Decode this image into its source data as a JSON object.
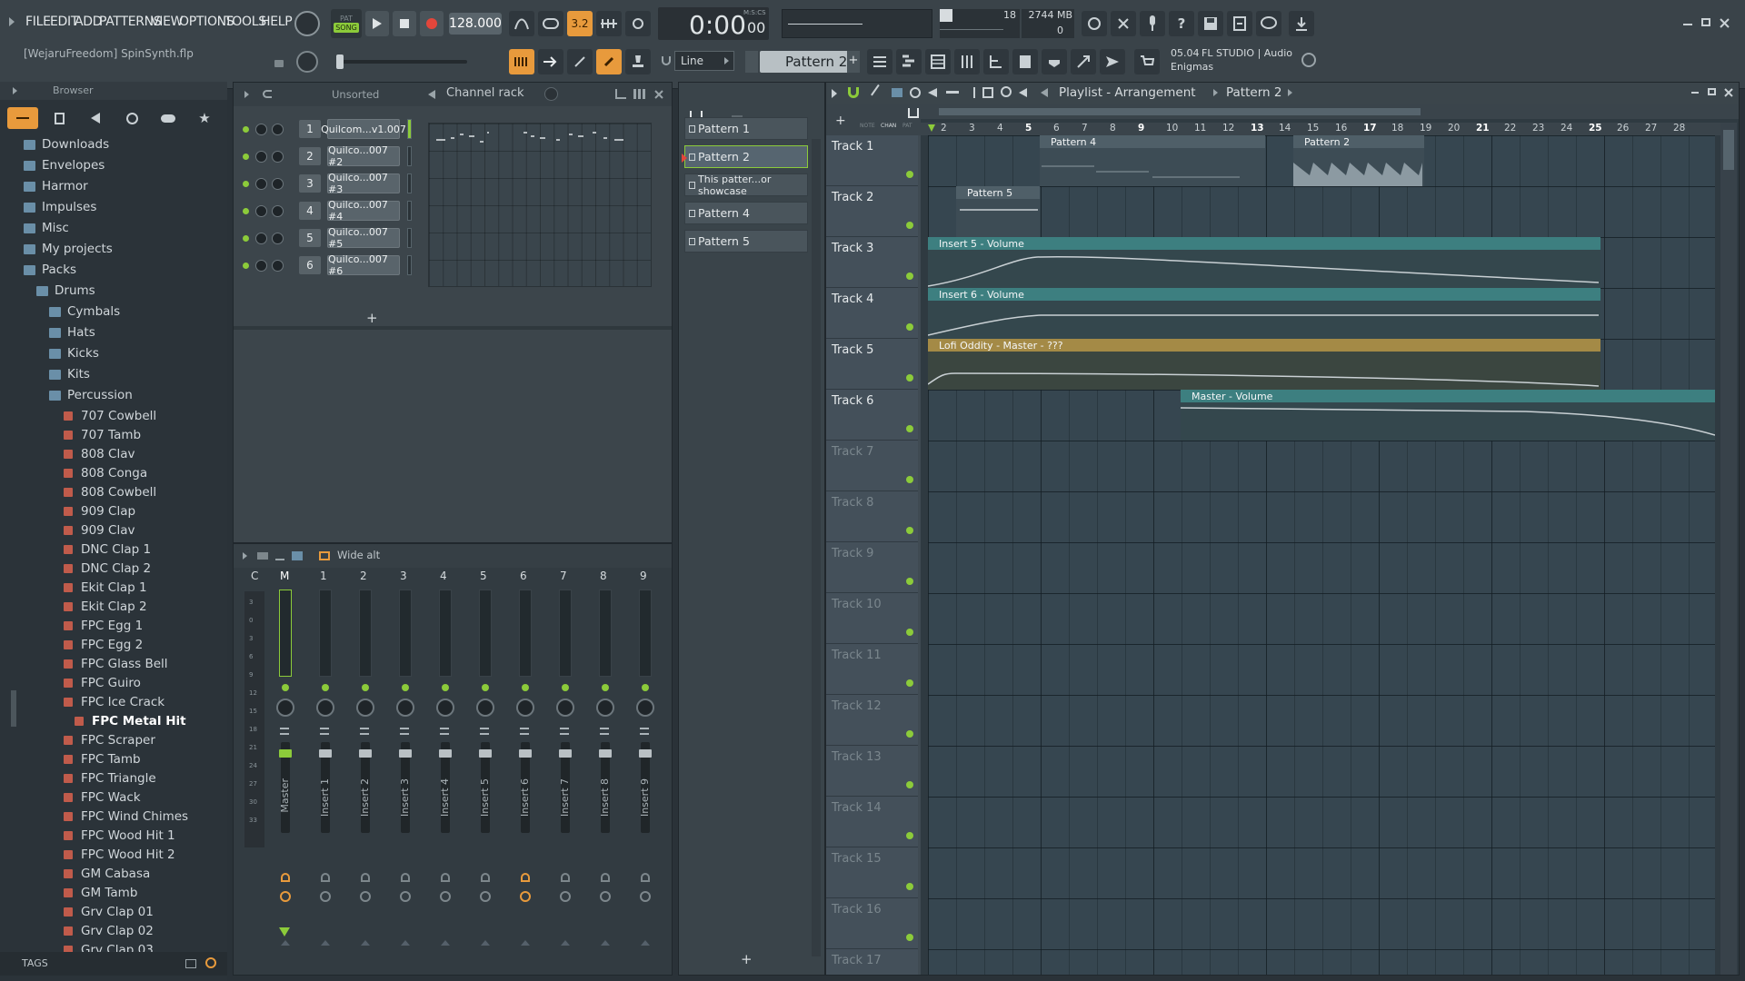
{
  "menu": [
    "FILE",
    "EDIT",
    "ADD",
    "PATTERNS",
    "VIEW",
    "OPTIONS",
    "TOOLS",
    "HELP"
  ],
  "project": {
    "file_label": "[WejaruFreedom] SpinSynth.flp"
  },
  "transport": {
    "mode_pat": "PAT",
    "mode_song": "SONG",
    "tempo": "128.000",
    "time": "0:00",
    "time_small": "00",
    "time_unit": "M:S:CS",
    "snap": "Line",
    "pattern": "Pattern 2",
    "small_digits": "3.2"
  },
  "meter": {
    "cpu": "18",
    "ram": "2744 MB",
    "poly": "0"
  },
  "news": {
    "version": "05.04",
    "text1": "FL STUDIO | Audio",
    "text2": "Enigmas"
  },
  "browser": {
    "title": "Browser",
    "folders": [
      "Downloads",
      "Envelopes",
      "Harmor",
      "Impulses",
      "Misc",
      "My projects",
      "Packs",
      "Drums",
      "Cymbals",
      "Hats",
      "Kicks",
      "Kits",
      "Percussion"
    ],
    "files": [
      "707 Cowbell",
      "707 Tamb",
      "808 Clav",
      "808 Conga",
      "808 Cowbell",
      "909 Clap",
      "909 Clav",
      "DNC Clap 1",
      "DNC Clap 2",
      "Ekit Clap 1",
      "Ekit Clap 2",
      "FPC Egg 1",
      "FPC Egg 2",
      "FPC Glass Bell",
      "FPC Guiro",
      "FPC Ice Crack",
      "FPC Metal Hit",
      "FPC Scraper",
      "FPC Tamb",
      "FPC Triangle",
      "FPC Wack",
      "FPC Wind Chimes",
      "FPC Wood Hit 1",
      "FPC Wood Hit 2",
      "GM Cabasa",
      "GM Tamb",
      "Grv Clap 01",
      "Grv Clap 02",
      "Grv Clap 03"
    ],
    "selected": "FPC Metal Hit",
    "tags": "TAGS"
  },
  "channel_rack": {
    "title": "Channel rack",
    "filter": "Unsorted",
    "channels": [
      {
        "num": "1",
        "name": "Quilcom...v1.007"
      },
      {
        "num": "2",
        "name": "Quilco...007 #2"
      },
      {
        "num": "3",
        "name": "Quilco...007 #3"
      },
      {
        "num": "4",
        "name": "Quilco...007 #4"
      },
      {
        "num": "5",
        "name": "Quilco...007 #5"
      },
      {
        "num": "6",
        "name": "Quilco...007 #6"
      }
    ],
    "add": "+"
  },
  "mixer": {
    "preset": "Wide alt",
    "strips": [
      "C",
      "M",
      "1",
      "2",
      "3",
      "4",
      "5",
      "6",
      "7",
      "8",
      "9"
    ],
    "scale": [
      "3",
      "0",
      "3",
      "6",
      "9",
      "12",
      "15",
      "18",
      "21",
      "24",
      "27",
      "30",
      "33"
    ],
    "labels": [
      "Master",
      "Insert 1",
      "Insert 2",
      "Insert 3",
      "Insert 4",
      "Insert 5",
      "Insert 6",
      "Insert 7",
      "Insert 8",
      "Insert 9"
    ]
  },
  "picker": {
    "patterns": [
      "Pattern 1",
      "Pattern 2",
      "This patter...or showcase",
      "Pattern 4",
      "Pattern 5"
    ],
    "add": "+"
  },
  "playlist": {
    "title": "Playlist - Arrangement",
    "crumb": "Pattern 2",
    "header_labels": [
      "NOTE",
      "CHAN",
      "PAT"
    ],
    "ruler": [
      "2",
      "3",
      "4",
      "5",
      "6",
      "7",
      "8",
      "9",
      "10",
      "11",
      "12",
      "13",
      "14",
      "15",
      "16",
      "17",
      "18",
      "19",
      "20",
      "21",
      "22",
      "23",
      "24",
      "25",
      "26",
      "27",
      "28"
    ],
    "tracks": [
      "Track 1",
      "Track 2",
      "Track 3",
      "Track 4",
      "Track 5",
      "Track 6",
      "Track 7",
      "Track 8",
      "Track 9",
      "Track 10",
      "Track 11",
      "Track 12",
      "Track 13",
      "Track 14",
      "Track 15",
      "Track 16",
      "Track 17"
    ],
    "clips": {
      "t1a": "Pattern 4",
      "t1b": "Pattern 2",
      "t2": "Pattern 5",
      "t3": "Insert 5 - Volume",
      "t4": "Insert 6 - Volume",
      "t5": "Lofi Oddity - Master - ???",
      "t6": "Master - Volume"
    }
  },
  "colors": {
    "accent": "#8ccb3a",
    "orange": "#e89a3c",
    "automation": "#3d7f80",
    "automation_gold": "#a48a46",
    "pattern_clip": "#566670"
  }
}
